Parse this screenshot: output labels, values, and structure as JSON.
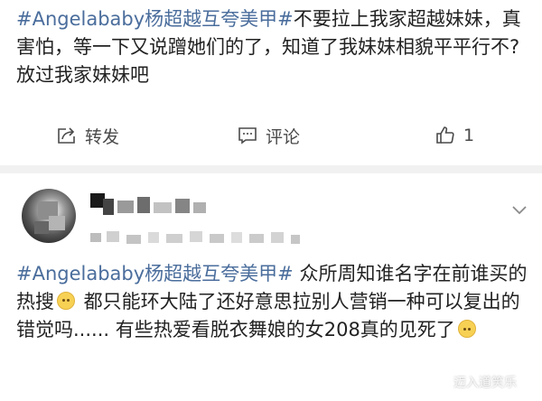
{
  "post1": {
    "hashtag": "#Angelababy杨超越互夸美甲#",
    "body": "不要拉上我家超越妹妹，真害怕，等一下又说蹭她们的了，知道了我妹妹相貌平平行不?放过我家妹妹吧"
  },
  "actions": {
    "repost_label": "转发",
    "comment_label": "评论",
    "like_count": "1"
  },
  "post2": {
    "hashtag": "#Angelababy杨超越互夸美甲#",
    "body_part1": " 众所周知谁名字在前谁买的热搜",
    "body_part2": " 都只能环大陆了还好意思拉别人营销一种可以复出的错觉吗...... 有些热爱看脱衣舞娘的女208真的见死了",
    "username_blurred": "ZL"
  },
  "icons": {
    "repost": "repost-icon",
    "comment": "comment-icon",
    "like": "thumbs-up-icon",
    "menu": "chevron-down-icon",
    "emoji1": "smile-emoji-icon",
    "emoji2": "sweat-emoji-icon"
  },
  "colors": {
    "hashtag": "#4a6d9c",
    "text": "#222222",
    "icon": "#4a4a4a",
    "divider": "#f1f1f1"
  },
  "watermark": "迈入道笑乐"
}
